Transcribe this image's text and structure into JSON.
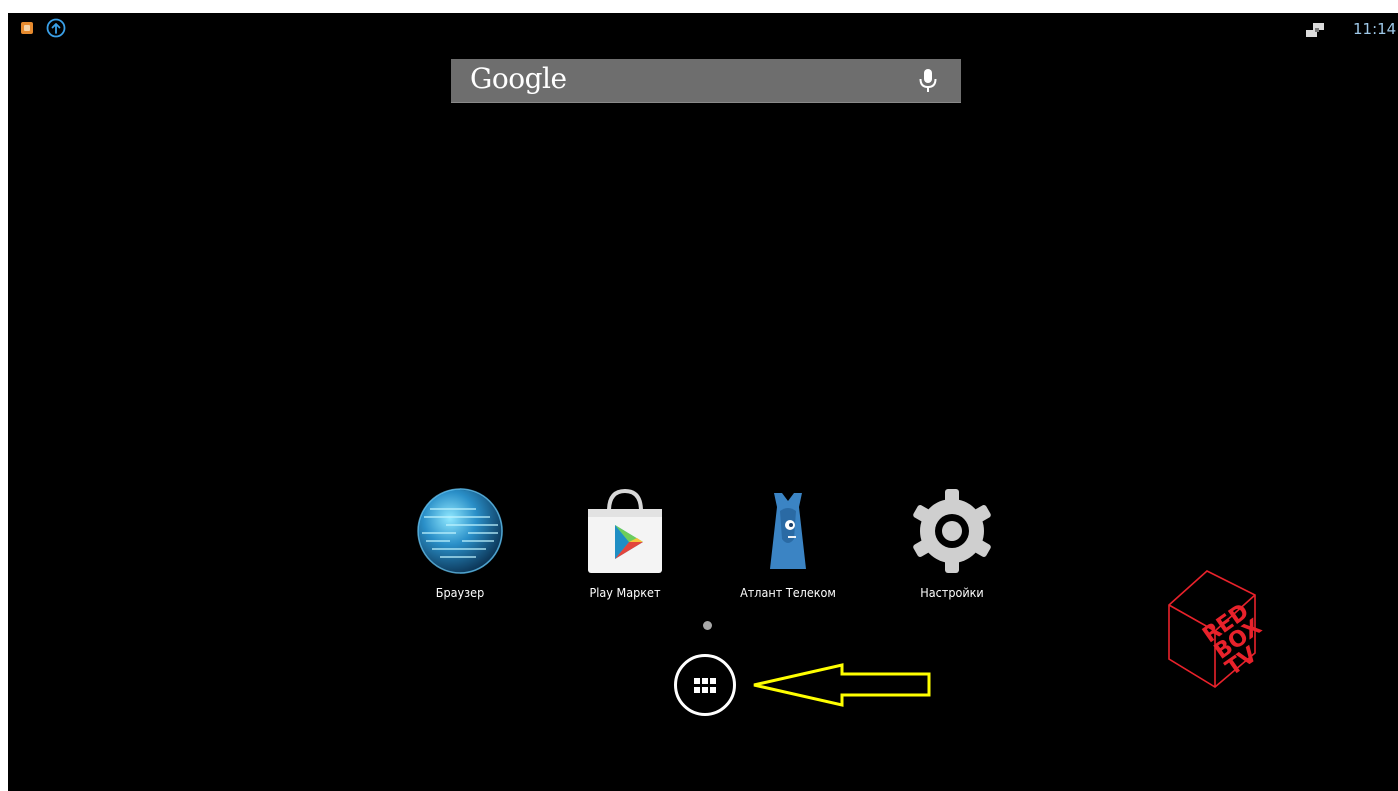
{
  "status_bar": {
    "left_icons": [
      "app-notification-icon",
      "update-arrow-icon"
    ],
    "right_icons": [
      "ethernet-icon"
    ],
    "clock": "11:14"
  },
  "search_widget": {
    "logo_text": "Google",
    "mic_icon": "microphone-icon"
  },
  "apps": [
    {
      "label": "Браузер",
      "icon": "globe-icon"
    },
    {
      "label": "Play Маркет",
      "icon": "play-store-icon"
    },
    {
      "label": "Атлант Телеком",
      "icon": "atlant-telecom-icon"
    },
    {
      "label": "Настройки",
      "icon": "gear-icon"
    }
  ],
  "all_apps_button": {
    "icon": "app-grid-icon"
  },
  "annotation": {
    "type": "arrow",
    "color": "#ffff00",
    "direction": "left"
  },
  "brand_logo": {
    "text_lines": [
      "RED",
      "BOX",
      "TV"
    ],
    "color": "#e8222b"
  },
  "colors": {
    "background": "#000000",
    "search_bar": "#6e6e6e",
    "clock": "#9ec8e8",
    "highlight_arrow": "#ffff00"
  }
}
